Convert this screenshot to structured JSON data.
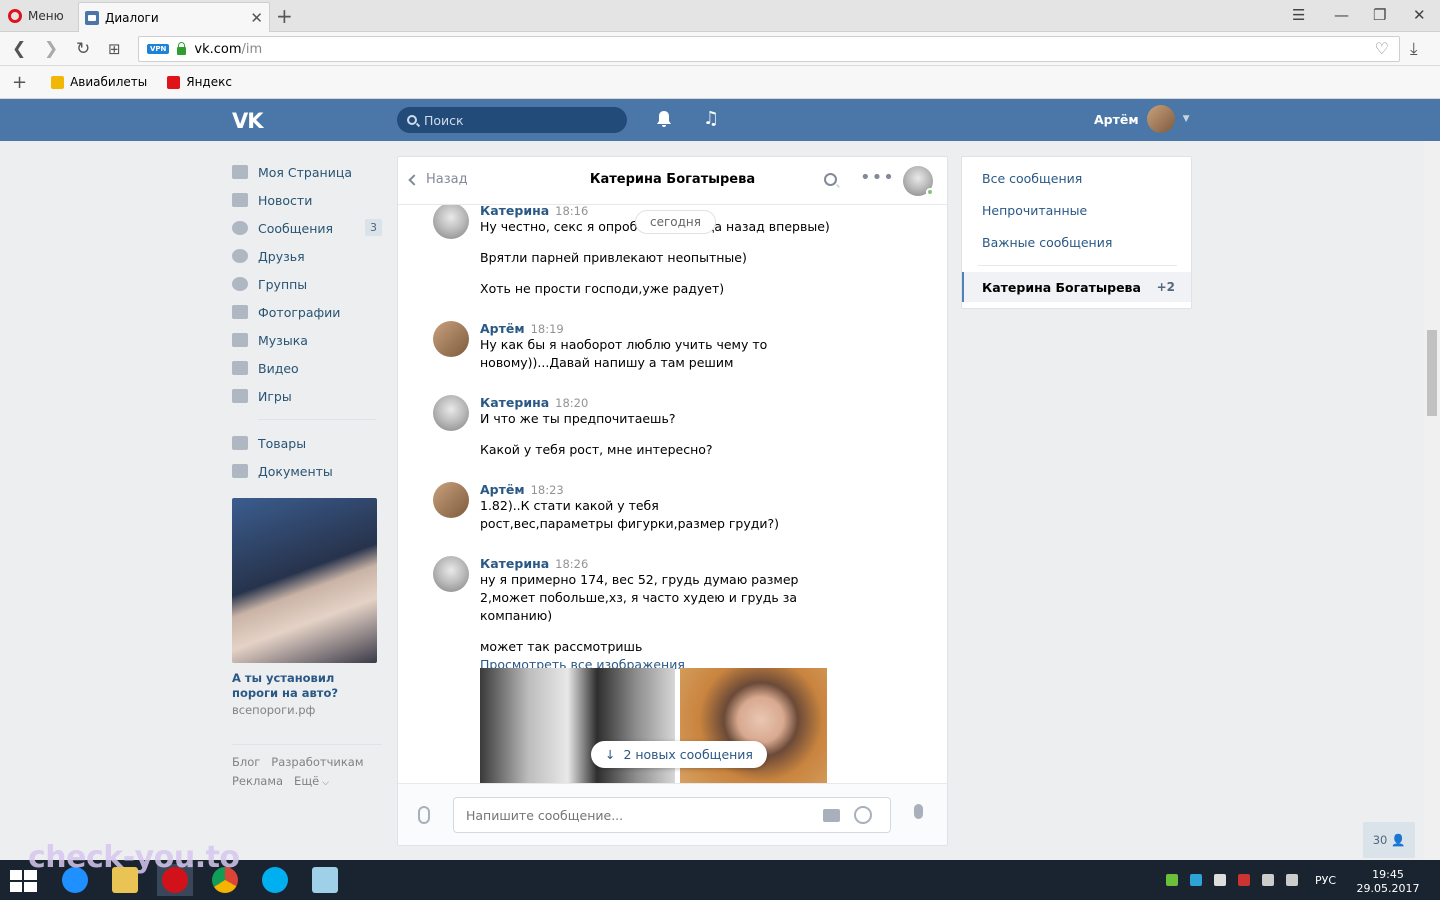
{
  "browser": {
    "menu_label": "Меню",
    "tab_title": "Диалоги",
    "url_host": "vk.com",
    "url_path": "/im",
    "vpn_badge": "VPN",
    "bookmarks": [
      {
        "label": "Авиабилеты"
      },
      {
        "label": "Яндекс"
      }
    ]
  },
  "vk": {
    "logo": "VK",
    "search_placeholder": "Поиск",
    "user_name": "Артём"
  },
  "left_menu": {
    "items": [
      {
        "label": "Моя Страница",
        "icon": "home-icon"
      },
      {
        "label": "Новости",
        "icon": "news-icon"
      },
      {
        "label": "Сообщения",
        "icon": "messages-icon",
        "badge": "3"
      },
      {
        "label": "Друзья",
        "icon": "friends-icon"
      },
      {
        "label": "Группы",
        "icon": "groups-icon"
      },
      {
        "label": "Фотографии",
        "icon": "camera-icon"
      },
      {
        "label": "Музыка",
        "icon": "music-icon"
      },
      {
        "label": "Видео",
        "icon": "video-icon"
      },
      {
        "label": "Игры",
        "icon": "gamepad-icon"
      }
    ],
    "items2": [
      {
        "label": "Товары",
        "icon": "bag-icon"
      },
      {
        "label": "Документы",
        "icon": "document-icon"
      }
    ]
  },
  "ad": {
    "title": "А ты установил пороги на авто?",
    "domain": "всепороги.рф"
  },
  "footer_links": {
    "blog": "Блог",
    "dev": "Разработчикам",
    "ads": "Реклама",
    "more": "Ещё"
  },
  "chat": {
    "back_label": "Назад",
    "peer_name": "Катерина Богатырева",
    "date_divider": "сегодня",
    "messages": [
      {
        "author": "Катерина",
        "time": "18:16",
        "lines": [
          "Ну честно, секс я опробовала 2 года назад впервые)",
          "Врятли парней привлекают неопытные)",
          "Хоть не прости господи,уже радует)"
        ]
      },
      {
        "author": "Артём",
        "time": "18:19",
        "lines": [
          "Ну как бы я наоборот люблю учить чему то новому))...Давай напишу а там решим"
        ]
      },
      {
        "author": "Катерина",
        "time": "18:20",
        "lines": [
          "И что же ты предпочитаешь?",
          "Какой у тебя рост, мне интересно?"
        ]
      },
      {
        "author": "Артём",
        "time": "18:23",
        "lines": [
          "1.82)..К стати какой у тебя рост,вес,параметры фигурки,размер груди?)"
        ]
      },
      {
        "author": "Катерина",
        "time": "18:26",
        "lines": [
          "ну я примерно 174, вес 52, грудь думаю размер 2,может побольше,хз, я часто худею и грудь за компанию)",
          "может так рассмотришь"
        ],
        "link": "Просмотреть все изображения"
      }
    ],
    "new_messages": "2 новых сообщения",
    "composer_placeholder": "Напишите сообщение..."
  },
  "right_panel": {
    "all": "Все сообщения",
    "unread": "Непрочитанные",
    "important": "Важные сообщения",
    "active_name": "Катерина Богатырева",
    "active_count": "+2"
  },
  "online_count": "30",
  "taskbar": {
    "lang": "РУС",
    "time": "19:45",
    "date": "29.05.2017"
  },
  "watermark": "check-you.to"
}
